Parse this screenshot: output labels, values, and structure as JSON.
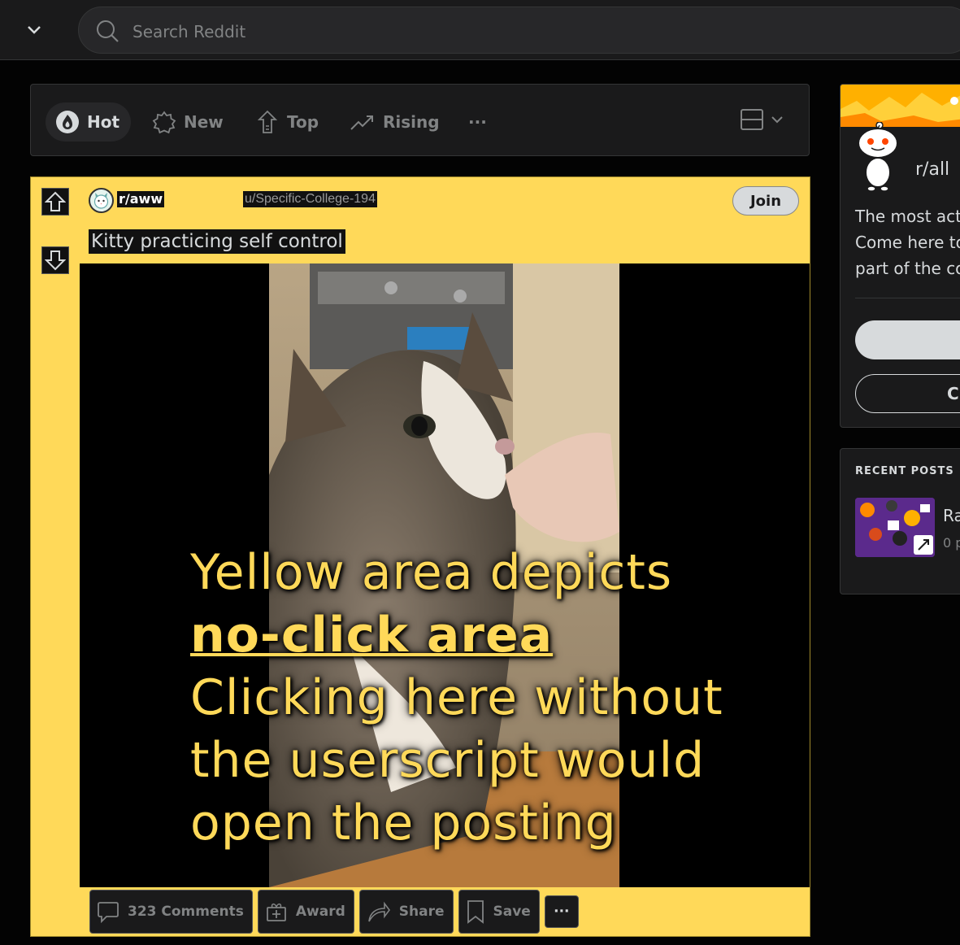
{
  "header": {
    "search_placeholder": "Search Reddit"
  },
  "sort_bar": {
    "items": [
      {
        "label": "Hot",
        "active": true
      },
      {
        "label": "New",
        "active": false
      },
      {
        "label": "Top",
        "active": false
      },
      {
        "label": "Rising",
        "active": false
      }
    ],
    "more_label": "···"
  },
  "post": {
    "subreddit": "r/aww",
    "author": "u/Specific-College-194",
    "join_label": "Join",
    "title": "Kitty practicing self control",
    "overlay": {
      "line1": "Yellow area depicts",
      "line2": "no-click area",
      "line3": "Clicking here without",
      "line4": "the userscript would",
      "line5": "open the posting"
    },
    "actions": {
      "comments": "323 Comments",
      "award": "Award",
      "share": "Share",
      "save": "Save",
      "more": "···"
    },
    "highlight_color": "#ffd959"
  },
  "sidebar": {
    "community": {
      "name": "r/all",
      "description_lines": [
        "The most acti",
        "Come here to",
        "part of the co"
      ],
      "secondary_button": "C"
    },
    "recent_posts": {
      "heading": "RECENT POSTS",
      "item_title": "Ra",
      "item_meta": "0 p"
    }
  }
}
